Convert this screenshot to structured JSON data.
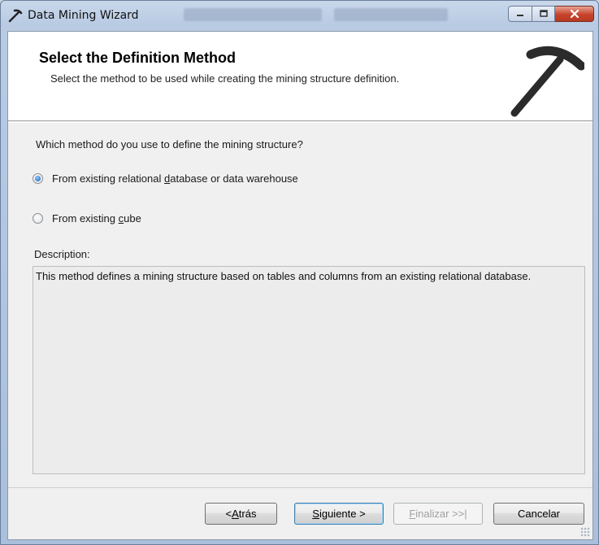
{
  "window": {
    "title": "Data Mining Wizard",
    "icon": "pickaxe-icon",
    "controls": [
      "minimize-icon",
      "maximize-icon",
      "close-icon"
    ]
  },
  "header": {
    "title": "Select the Definition Method",
    "subtitle": "Select the method to be used while creating the mining structure definition.",
    "logo": "pickaxe-logo-icon"
  },
  "body": {
    "question": "Which method do you use to define the mining structure?",
    "options": [
      {
        "label_pre": "From existing relational ",
        "label_key": "d",
        "label_post": "atabase or data warehouse",
        "selected": true
      },
      {
        "label_pre": "From existing ",
        "label_key": "c",
        "label_post": "ube",
        "selected": false
      }
    ],
    "description_label": "Description:",
    "description_text": "This method defines a mining structure based on tables and columns from an existing relational database."
  },
  "footer": {
    "back": {
      "pre": "< ",
      "key": "A",
      "post": "trás"
    },
    "next": {
      "pre": "",
      "key": "S",
      "post": "iguiente >"
    },
    "finish": {
      "pre": "",
      "key": "F",
      "post": "inalizar >>|",
      "enabled": false
    },
    "cancel": {
      "label": "Cancelar"
    }
  },
  "colors": {
    "accent_selected": "#1a5fb4",
    "close_button": "#c6432b"
  }
}
